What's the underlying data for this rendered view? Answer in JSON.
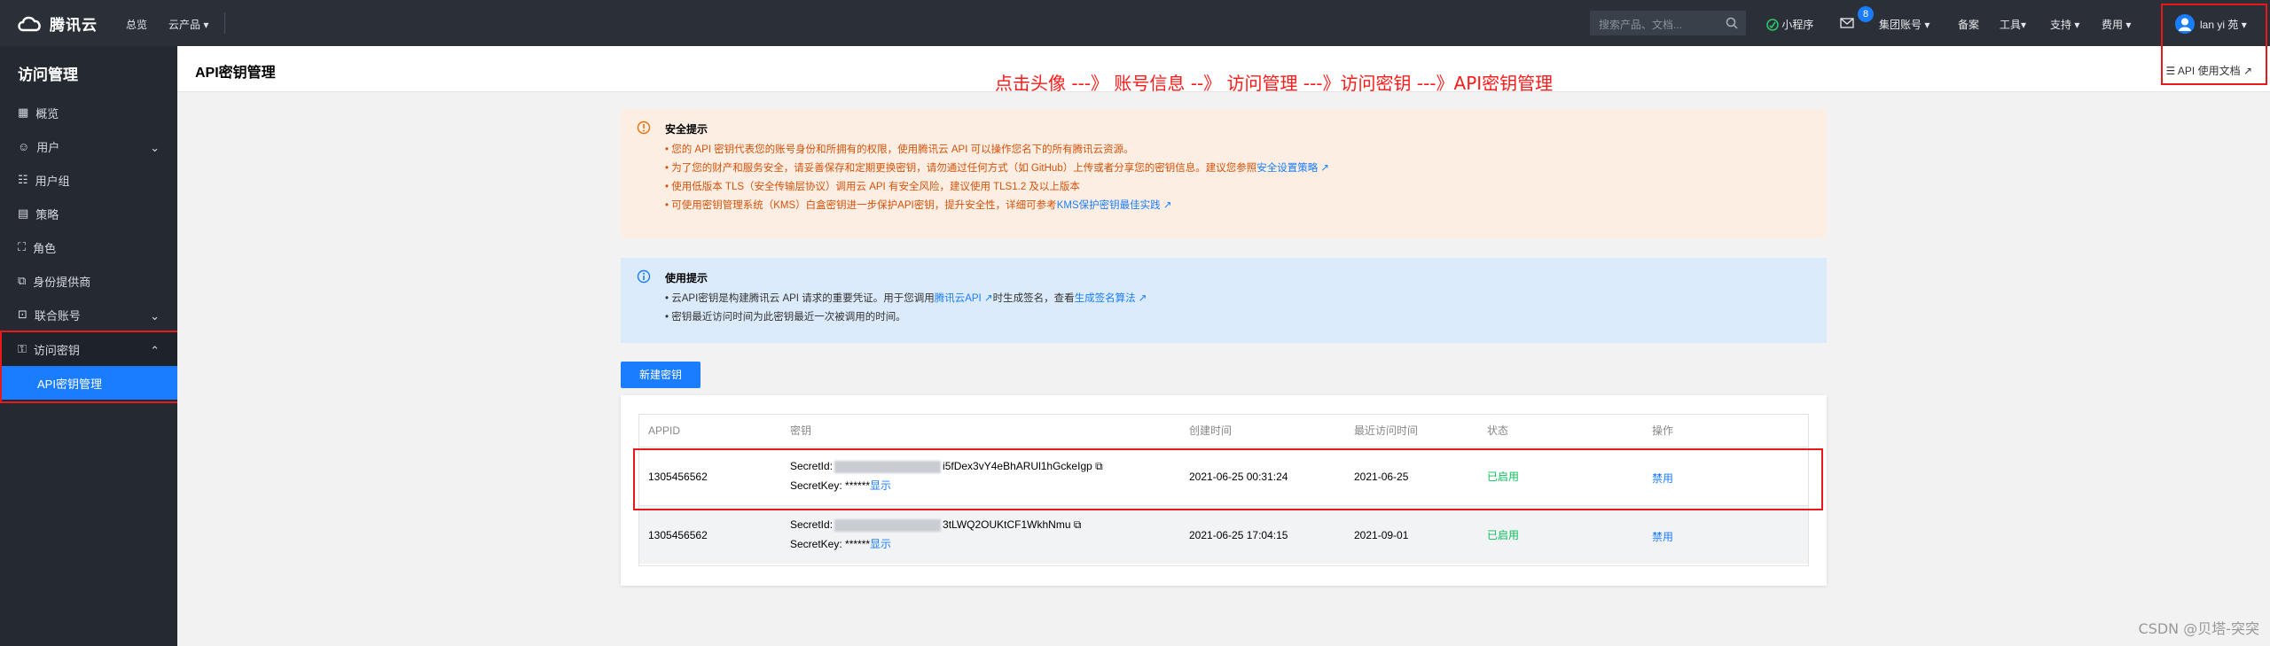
{
  "topbar": {
    "brand": "腾讯云",
    "nav_overview": "总览",
    "nav_products": "云产品",
    "search_placeholder": "搜索产品、文档...",
    "mini_program": "小程序",
    "message_count": "8",
    "group_account": "集团账号",
    "beian": "备案",
    "tools": "工具",
    "support": "支持",
    "billing": "费用",
    "user_name": "lan yi 苑"
  },
  "sidebar": {
    "title": "访问管理",
    "items": [
      {
        "label": "概览"
      },
      {
        "label": "用户"
      },
      {
        "label": "用户组"
      },
      {
        "label": "策略"
      },
      {
        "label": "角色"
      },
      {
        "label": "身份提供商"
      },
      {
        "label": "联合账号"
      },
      {
        "label": "访问密钥"
      }
    ],
    "sub_item": "API密钥管理"
  },
  "page": {
    "title": "API密钥管理",
    "doc_link": "API 使用文档",
    "annotation": "点击头像  ---》 账号信息  --》 访问管理 ---》访问密钥  ---》API密钥管理"
  },
  "security_alert": {
    "title": "安全提示",
    "lines": [
      "您的 API 密钥代表您的账号身份和所拥有的权限，使用腾讯云 API 可以操作您名下的所有腾讯云资源。",
      "为了您的财产和服务安全，请妥善保存和定期更换密钥，请勿通过任何方式（如 GitHub）上传或者分享您的密钥信息。建议您参照",
      "使用低版本 TLS（安全传输层协议）调用云 API 有安全风险，建议使用 TLS1.2 及以上版本",
      "可使用密钥管理系统（KMS）白盒密钥进一步保护API密钥，提升安全性，详细可参考"
    ],
    "link_policy": "安全设置策略",
    "link_kms": "KMS保护密钥最佳实践"
  },
  "usage_alert": {
    "title": "使用提示",
    "line1_prefix": "云API密钥是构建腾讯云 API 请求的重要凭证。用于您调用",
    "line1_link1": "腾讯云API",
    "line1_mid": "时生成签名，查看",
    "line1_link2": "生成签名算法",
    "line2": "密钥最近访问时间为此密钥最近一次被调用的时间。"
  },
  "new_key_button": "新建密钥",
  "table": {
    "headers": [
      "APPID",
      "密钥",
      "创建时间",
      "最近访问时间",
      "状态",
      "操作"
    ],
    "rows": [
      {
        "appid": "1305456562",
        "secret_id_label": "SecretId:",
        "secret_id_tail": "i5fDex3vY4eBhARUl1hGckeIgp",
        "secret_key_label": "SecretKey: ******",
        "show": "显示",
        "created": "2021-06-25 00:31:24",
        "last_access": "2021-06-25",
        "status": "已启用",
        "action": "禁用"
      },
      {
        "appid": "1305456562",
        "secret_id_label": "SecretId:",
        "secret_id_tail": "3tLWQ2OUKtCF1WkhNmu",
        "secret_key_label": "SecretKey: ******",
        "show": "显示",
        "created": "2021-06-25 17:04:15",
        "last_access": "2021-09-01",
        "status": "已启用",
        "action": "禁用"
      }
    ]
  },
  "watermark": "CSDN @贝塔-突突",
  "colors": {
    "accent": "#1a7dff",
    "annotation_red": "#e8191b",
    "enabled_green": "#0abf5b",
    "warning_orange": "#d4520a"
  }
}
